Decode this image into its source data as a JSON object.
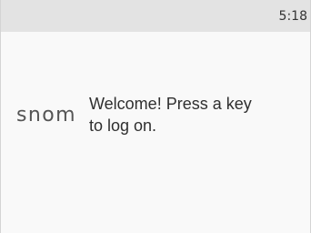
{
  "status_bar": {
    "time": "5:18"
  },
  "main": {
    "logo_text": "snom",
    "message_lines": [
      "Welcome! Press a key",
      "to log on."
    ]
  }
}
